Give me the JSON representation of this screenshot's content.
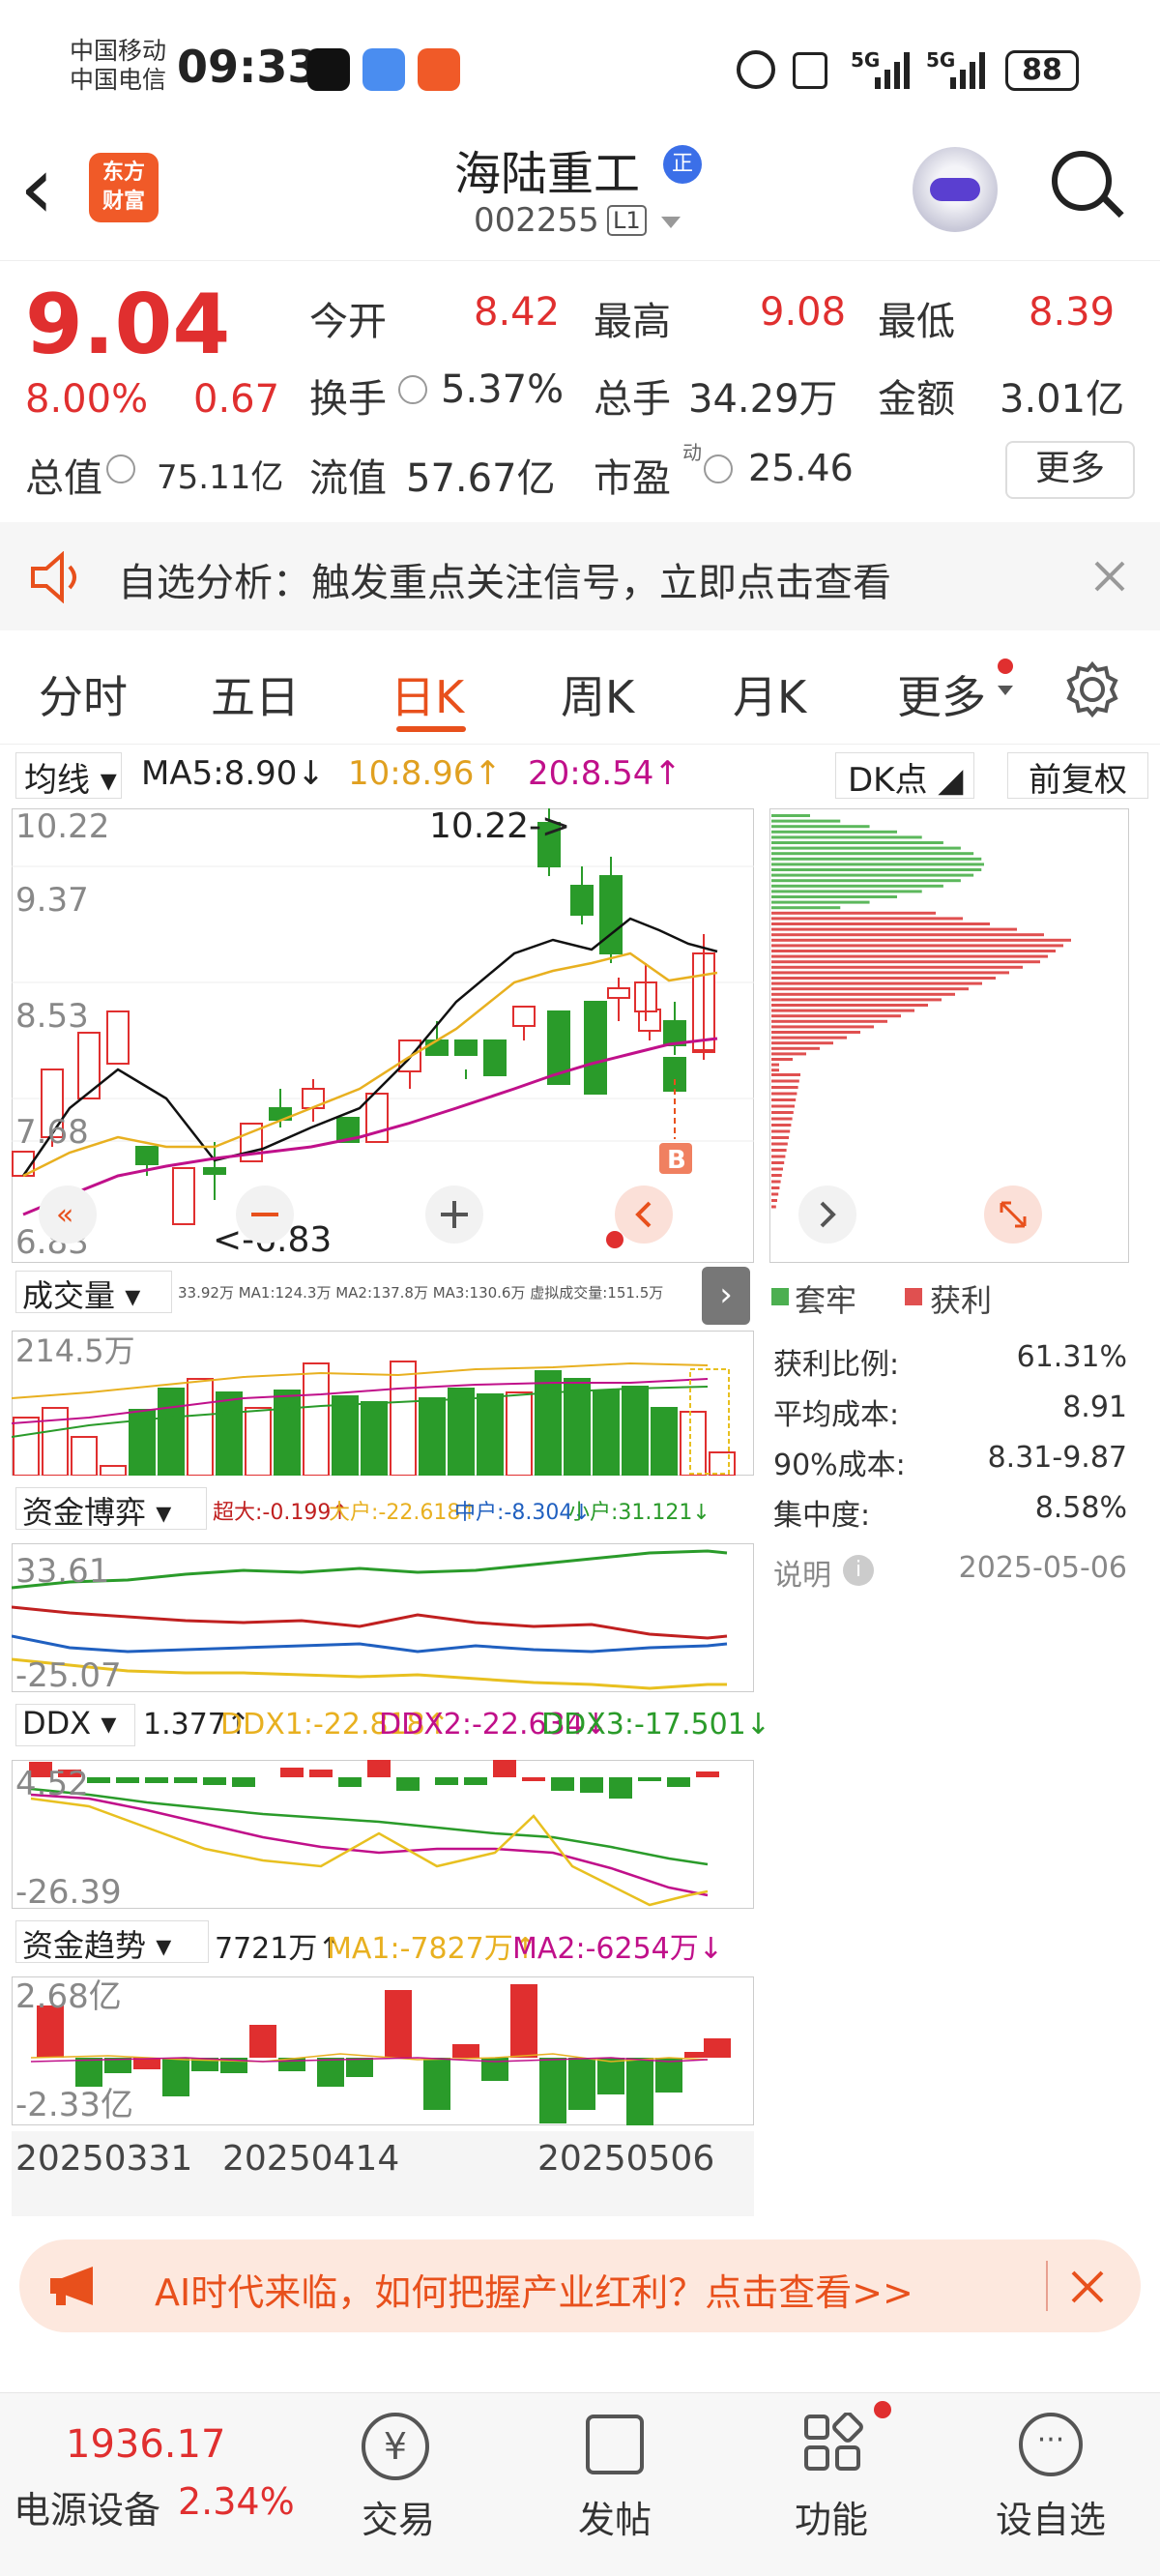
{
  "status": {
    "carrier1": "中国移动",
    "carrier2": "中国电信",
    "time": "09:33",
    "battery": "88",
    "net1": "5G",
    "net2": "5G"
  },
  "header": {
    "back": "‹",
    "logo_line1": "东方",
    "logo_line2": "财富",
    "title": "海陆重工",
    "badge": "正",
    "code": "002255",
    "level": "L1"
  },
  "quote": {
    "price": "9.04",
    "pct": "8.00%",
    "chg": "0.67",
    "open_label": "今开",
    "open": "8.42",
    "high_label": "最高",
    "high": "9.08",
    "low_label": "最低",
    "low": "8.39",
    "turnover_label": "换手",
    "turnover": "5.37%",
    "volume_label": "总手",
    "volume": "34.29万",
    "amount_label": "金额",
    "amount": "3.01亿",
    "mcap_label": "总值",
    "mcap": "75.11亿",
    "float_label": "流值",
    "float": "57.67亿",
    "pe_label": "市盈",
    "pe_sup": "动",
    "pe": "25.46",
    "more": "更多"
  },
  "banner": {
    "text": "自选分析：触发重点关注信号，立即点击查看"
  },
  "tabs": [
    "分时",
    "五日",
    "日K",
    "周K",
    "月K",
    "更多"
  ],
  "kline": {
    "ma_label": "均线",
    "ma5": "MA5:8.90↓",
    "ma10": "10:8.96↑",
    "ma20": "20:8.54↑",
    "dk": "DK点",
    "fq": "前复权",
    "y_top": "10.22",
    "y_2": "9.37",
    "y_3": "8.53",
    "y_4": "7.68",
    "y_bottom": "6.83",
    "max_note": "10.22->",
    "min_note": "<-6.83",
    "b_mark": "B"
  },
  "vol": {
    "label": "成交量",
    "vals": "33.92万 MA1:124.3万 MA2:137.8万 MA3:130.6万 虚拟成交量:151.5万",
    "y_top": "214.5万"
  },
  "fund": {
    "label": "资金博弈",
    "super": "超大:-0.199↑",
    "big": "大户:-22.618↑",
    "mid": "中户:-8.304↓",
    "small": "小户:31.121↓",
    "y_top": "33.61",
    "y_bottom": "-25.07"
  },
  "ddx": {
    "label": "DDX",
    "v": "1.377↑",
    "d1": "DDX1:-22.818↑",
    "d2": "DDX2:-22.634↓",
    "d3": "DDX3:-17.501↓",
    "y_top": "4.52",
    "y_bottom": "-26.39"
  },
  "trend": {
    "label": "资金趋势",
    "v": "7721万↑",
    "ma1": "MA1:-7827万↑",
    "ma2": "MA2:-6254万↓",
    "y_top": "2.68亿",
    "y_bottom": "-2.33亿"
  },
  "dates": [
    "20250331",
    "20250414",
    "20250506"
  ],
  "chip": {
    "legend1": "套牢",
    "legend2": "获利",
    "r1_label": "获利比例:",
    "r1": "61.31%",
    "r2_label": "平均成本:",
    "r2": "8.91",
    "r3_label": "90%成本:",
    "r3": "8.31-9.87",
    "r4_label": "集中度:",
    "r4": "8.58%",
    "note_label": "说明",
    "date": "2025-05-06"
  },
  "ad": {
    "text": "AI时代来临，如何把握产业红利？点击查看>>"
  },
  "bottom": {
    "index": "1936.17",
    "sector": "电源设备",
    "sector_pct": "2.34%",
    "trade": "交易",
    "post": "发帖",
    "func": "功能",
    "fav": "设自选"
  },
  "colors": {
    "up": "#e02f2f",
    "down": "#2a9b2a",
    "accent": "#e8501c"
  }
}
